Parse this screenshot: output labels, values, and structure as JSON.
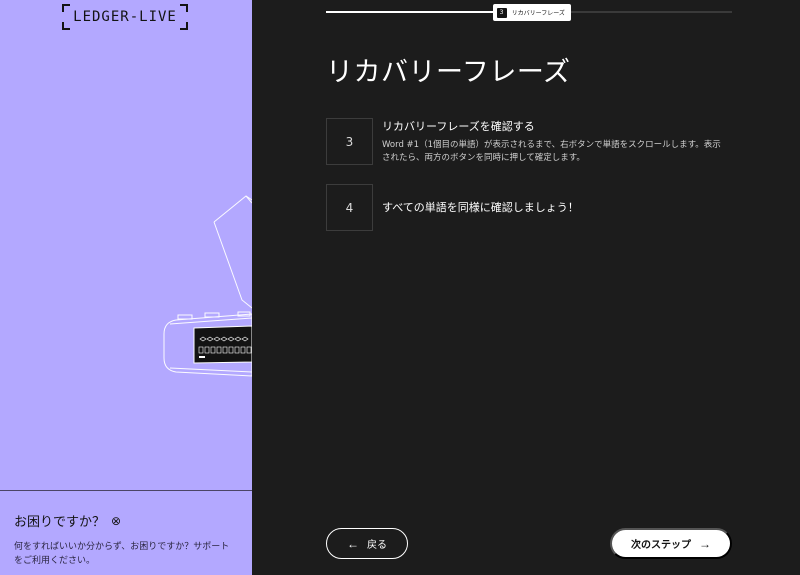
{
  "brand": {
    "logo_text": "LEDGER-LIVE"
  },
  "help": {
    "title": "お困りですか？",
    "icon": "question-circle-icon",
    "description": "何をすればいいか分からず、お困りですか？サポートをご利用ください。"
  },
  "progress": {
    "fraction": 0.43,
    "step_number": "3",
    "step_label": "リカバリーフレーズ"
  },
  "page": {
    "title": "リカバリーフレーズ"
  },
  "steps": [
    {
      "number": "3",
      "title": "リカバリーフレーズを確認する",
      "description": "Word #1（1個目の単語）が表示されるまで、右ボタンで単語をスクロールします。表示されたら、両方のボタンを同時に押して確定します。"
    },
    {
      "number": "4",
      "title": "すべての単語を同様に確認しましょう！"
    }
  ],
  "nav": {
    "back_label": "戻る",
    "next_label": "次のステップ"
  },
  "colors": {
    "left_panel": "#b3a8ff",
    "right_panel": "#1c1c1c",
    "accent_white": "#ffffff"
  }
}
